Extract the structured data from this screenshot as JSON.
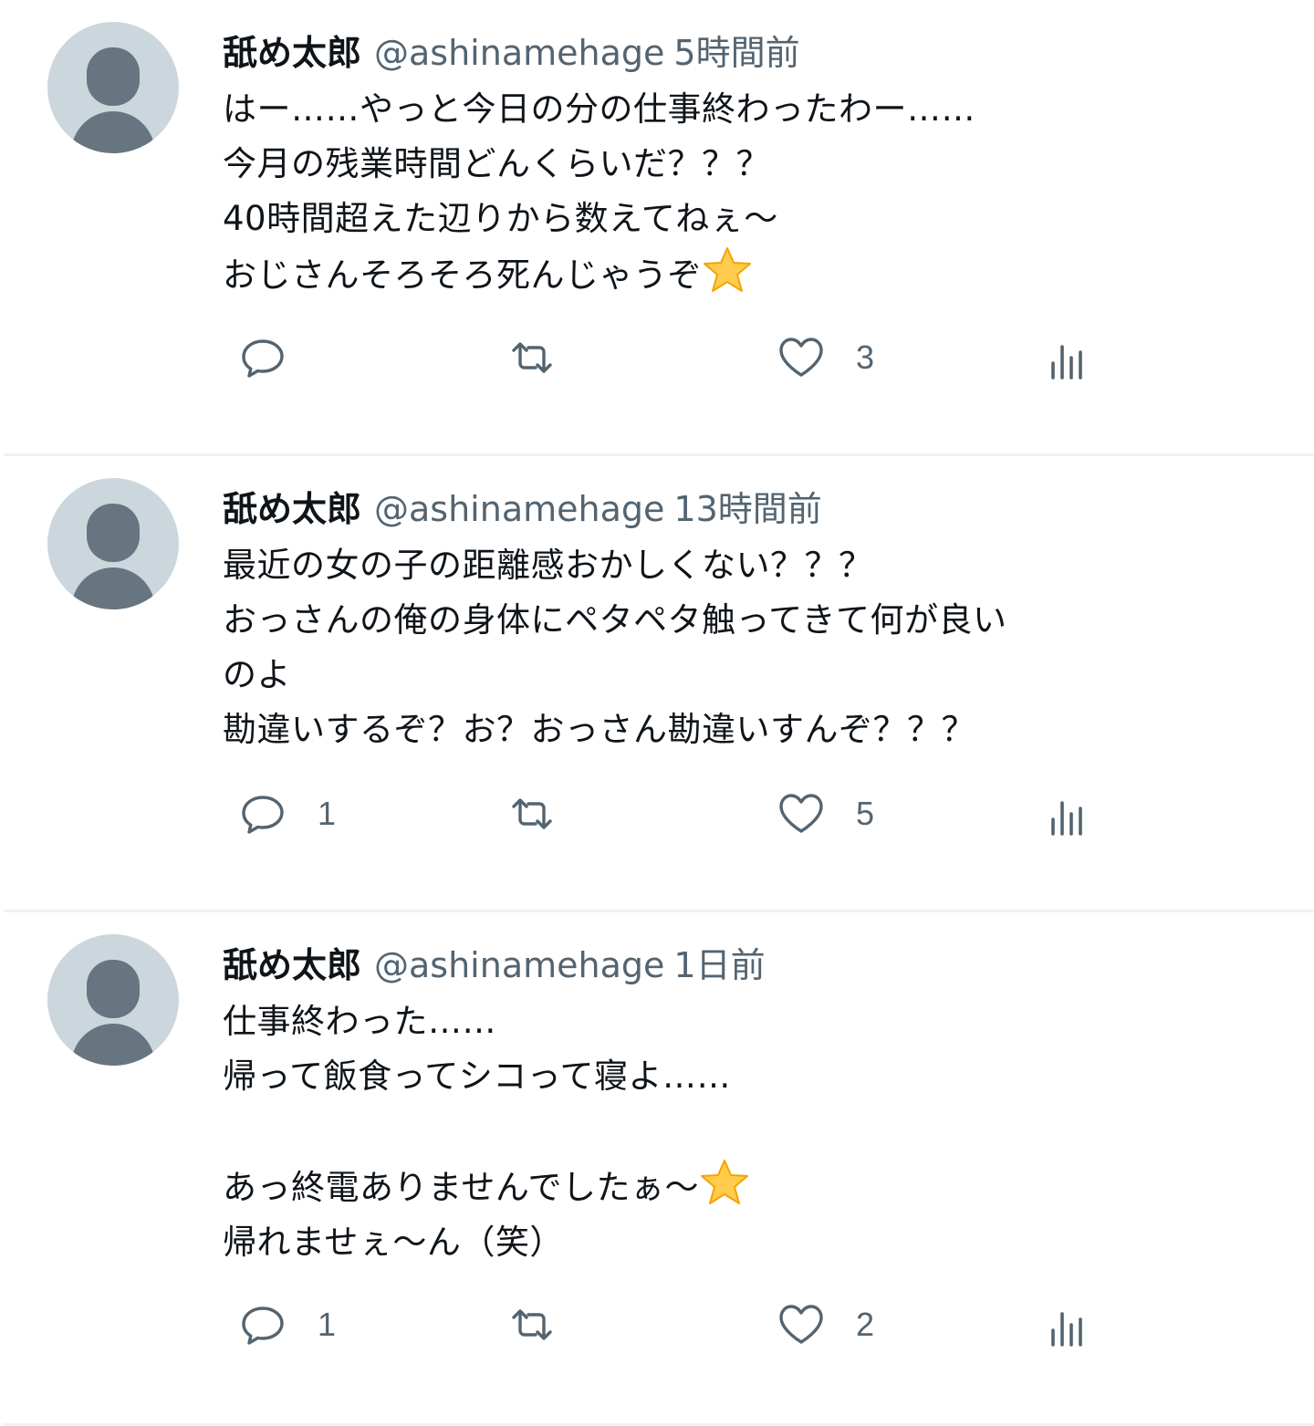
{
  "tweets": [
    {
      "display_name": "舐め太郎",
      "handle": "@ashinamehage",
      "time": "5時間前",
      "lines": [
        "はー……やっと今日の分の仕事終わったわー……",
        "今月の残業時間どんくらいだ？？？",
        "40時間超えた辺りから数えてねぇ〜",
        "おじさんそろそろ死んじゃうぞ"
      ],
      "replies": "",
      "retweets": "",
      "likes": "3",
      "icons": [
        "reply-icon",
        "retweet-icon",
        "heart-icon",
        "views-icon",
        "star-emoji"
      ]
    },
    {
      "display_name": "舐め太郎",
      "handle": "@ashinamehage",
      "time": "13時間前",
      "lines": [
        "最近の女の子の距離感おかしくない？？？",
        "おっさんの俺の身体にペタペタ触ってきて何が良い",
        "のよ",
        "勘違いするぞ？お？おっさん勘違いすんぞ？？？"
      ],
      "replies": "1",
      "retweets": "",
      "likes": "5"
    },
    {
      "display_name": "舐め太郎",
      "handle": "@ashinamehage",
      "time": "1日前",
      "lines": [
        "仕事終わった……",
        "帰って飯食ってシコって寝よ……",
        "",
        "あっ終電ありませんでしたぁ〜",
        "帰れませぇ〜ん（笑）"
      ],
      "replies": "1",
      "retweets": "",
      "likes": "2"
    }
  ],
  "colors": {
    "text": "#0f1419",
    "secondary": "#536471",
    "divider": "#eff3f4",
    "avatar_bg": "#ccd6dd",
    "avatar_fg": "#66757f",
    "star": "#ffcc4d"
  }
}
